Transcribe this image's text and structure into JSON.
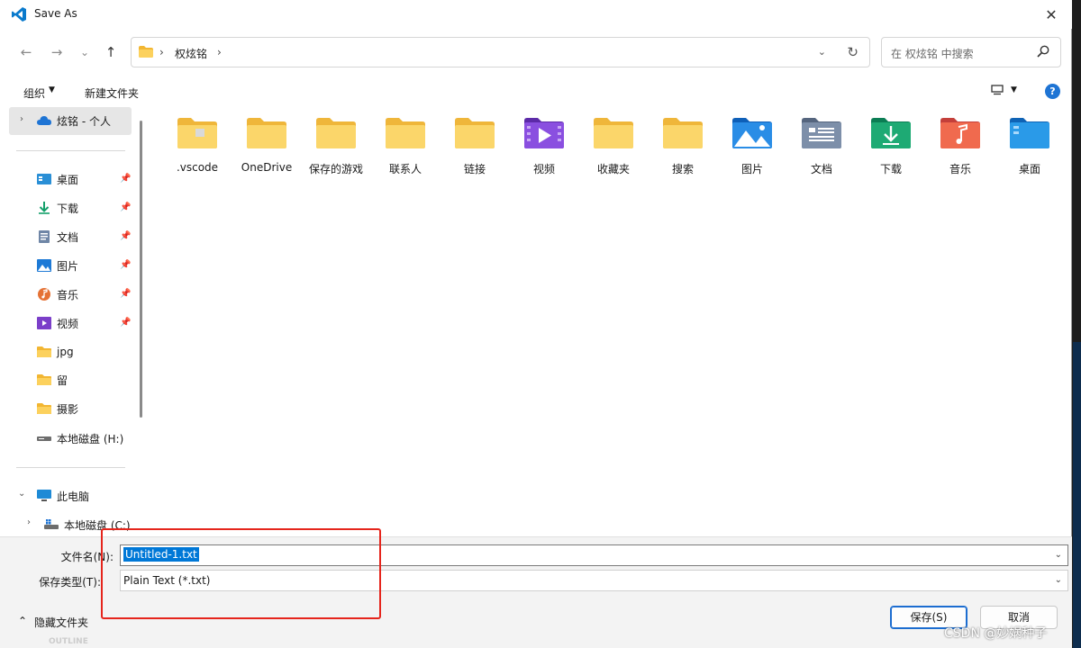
{
  "window": {
    "title": "Save As",
    "close_glyph": "✕"
  },
  "nav": {
    "back_glyph": "←",
    "forward_glyph": "→",
    "recent_glyph": "⌄",
    "up_glyph": "↑",
    "breadcrumb": [
      "权炫铭"
    ],
    "dropdown_glyph": "⌄",
    "refresh_glyph": "↻",
    "search_placeholder": "在 权炫铭 中搜索"
  },
  "toolbar": {
    "organize": "组织",
    "organize_caret": "▼",
    "new_folder": "新建文件夹",
    "view_caret": "▼",
    "help_glyph": "?"
  },
  "sidebar": {
    "top_item": "炫铭 - 个人",
    "quick_access": [
      {
        "label": "桌面",
        "icon": "desktop-icon",
        "pinned": true
      },
      {
        "label": "下载",
        "icon": "download-icon",
        "pinned": true
      },
      {
        "label": "文档",
        "icon": "document-icon",
        "pinned": true
      },
      {
        "label": "图片",
        "icon": "picture-icon",
        "pinned": true
      },
      {
        "label": "音乐",
        "icon": "music-icon",
        "pinned": true
      },
      {
        "label": "视频",
        "icon": "video-icon",
        "pinned": true
      },
      {
        "label": "jpg",
        "icon": "folder-icon",
        "pinned": false
      },
      {
        "label": "留",
        "icon": "folder-icon",
        "pinned": false
      },
      {
        "label": "摄影",
        "icon": "folder-icon",
        "pinned": false
      },
      {
        "label": "本地磁盘 (H:)",
        "icon": "drive-icon",
        "pinned": false
      }
    ],
    "this_pc": "此电脑",
    "local_disk_c": "本地磁盘 (C:)"
  },
  "folders": [
    {
      "label": ".vscode",
      "icon": "vscode-folder-icon"
    },
    {
      "label": "OneDrive",
      "icon": "folder-icon"
    },
    {
      "label": "保存的游戏",
      "icon": "folder-icon"
    },
    {
      "label": "联系人",
      "icon": "folder-icon"
    },
    {
      "label": "链接",
      "icon": "folder-icon"
    },
    {
      "label": "视频",
      "icon": "video-folder-icon"
    },
    {
      "label": "收藏夹",
      "icon": "folder-icon"
    },
    {
      "label": "搜索",
      "icon": "folder-icon"
    },
    {
      "label": "图片",
      "icon": "pictures-folder-icon"
    },
    {
      "label": "文档",
      "icon": "documents-folder-icon"
    },
    {
      "label": "下载",
      "icon": "downloads-folder-icon"
    },
    {
      "label": "音乐",
      "icon": "music-folder-icon"
    },
    {
      "label": "桌面",
      "icon": "desktop-folder-icon"
    }
  ],
  "form": {
    "filename_label": "文件名(N):",
    "filename_value": "Untitled-1.txt",
    "filetype_label": "保存类型(T):",
    "filetype_value": "Plain Text (*.txt)",
    "hide_folders": "隐藏文件夹",
    "save_button": "保存(S)",
    "cancel_button": "取消"
  },
  "background": {
    "outline_label": "OUTLINE",
    "watermark": "CSDN @妙娲种子"
  },
  "colors": {
    "accent": "#0078d7",
    "highlight_box": "#e5251c",
    "folder_yellow": "#f8c74a"
  }
}
